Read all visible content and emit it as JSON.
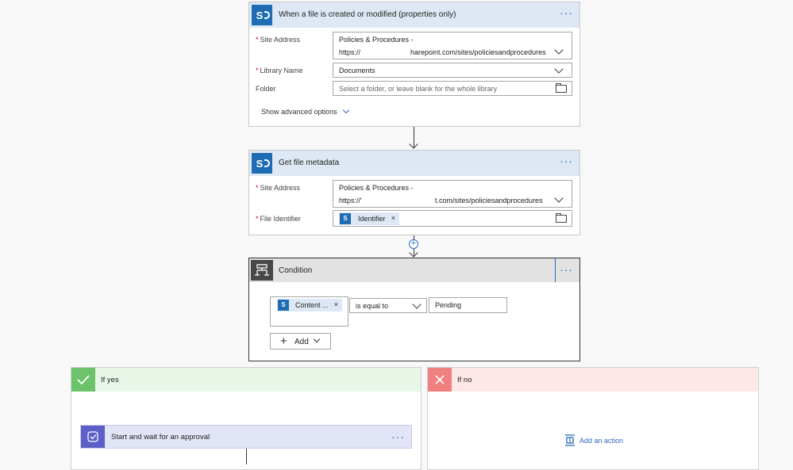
{
  "trigger": {
    "title": "When a file is created or modified (properties only)",
    "site_address_label": "Site Address",
    "site_address_line1": "Policies & Procedures -",
    "site_address_line2_a": "https://",
    "site_address_line2_b": "harepoint.com/sites/policiesandprocedures",
    "library_label": "Library Name",
    "library_value": "Documents",
    "folder_label": "Folder",
    "folder_placeholder": "Select a folder, or leave blank for the whole library",
    "advanced_label": "Show advanced options"
  },
  "metadata": {
    "title": "Get file metadata",
    "site_address_label": "Site Address",
    "site_address_line1": "Policies & Procedures -",
    "site_address_line2_a": "https://'",
    "site_address_line2_b": "t.com/sites/policiesandprocedures",
    "identifier_label": "File Identifier",
    "identifier_token": "Identifier",
    "token_remove": "×"
  },
  "condition": {
    "title": "Condition",
    "left_token": "Content ...",
    "token_remove": "×",
    "operator": "is equal to",
    "value": "Pending",
    "add_label": "Add"
  },
  "branches": {
    "yes_title": "If yes",
    "no_title": "If no",
    "add_action_label": "Add an action",
    "approval_title": "Start and wait for an approval"
  },
  "common": {
    "more_dots": "···",
    "required_mark": "*"
  },
  "colors": {
    "accent": "#2d6bbf",
    "sharepoint": "#1e6db4",
    "header_bg": "#dde8f4",
    "condition_header": "#e2e2e2",
    "condition_icon_bg": "#484848",
    "yes_header": "#e8f6e8",
    "yes_icon": "#6cc36c",
    "no_header": "#fde7e7",
    "no_icon": "#f08080",
    "approval_header": "#e2e4f7",
    "approval_icon": "#5b5fc7"
  }
}
